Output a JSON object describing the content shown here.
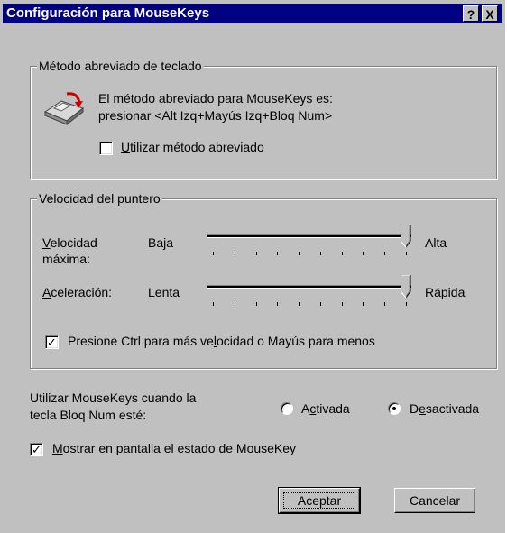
{
  "window": {
    "title": "Configuración para MouseKeys",
    "help_button": "?",
    "close_button": "X"
  },
  "shortcut_group": {
    "legend": "Método abreviado de teclado",
    "description_line1": "El método abreviado para MouseKeys es:",
    "description_line2": "presionar <Alt Izq+Mayús Izq+Bloq Num>",
    "use_shortcut": {
      "label_underlined": "U",
      "label_rest": "tilizar método abreviado",
      "checked": false
    }
  },
  "pointer_group": {
    "legend": "Velocidad del puntero",
    "max_speed": {
      "label_underlined": "V",
      "label_rest_line1": "elocidad",
      "label_line2": "máxima:",
      "min_label": "Baja",
      "max_label": "Alta",
      "level": 1.0,
      "tick_count": 10
    },
    "acceleration": {
      "label_underlined": "A",
      "label_rest": "celeración:",
      "min_label": "Lenta",
      "max_label": "Rápida",
      "level": 1.0,
      "tick_count": 10
    },
    "ctrl_shift": {
      "label_before": "Presione Ctrl para más ve",
      "label_underlined": "l",
      "label_after": "ocidad o Mayús para menos",
      "checked": true
    }
  },
  "numlock": {
    "label_line1": "Utilizar MouseKeys cuando la",
    "label_line2": "tecla Bloq Num esté:",
    "on": {
      "label_before": "A",
      "label_underlined": "c",
      "label_after": "tivada",
      "selected": false
    },
    "off": {
      "label_before": "D",
      "label_underlined": "e",
      "label_after": "sactivada",
      "selected": true
    }
  },
  "show_status": {
    "label_underlined": "M",
    "label_rest": "ostrar en pantalla el estado de MouseKey",
    "checked": true
  },
  "buttons": {
    "ok": "Aceptar",
    "cancel": "Cancelar"
  },
  "icons": {
    "keyboard_shortcut": "keyboard-shortcut-icon",
    "check_mark": "✓"
  }
}
